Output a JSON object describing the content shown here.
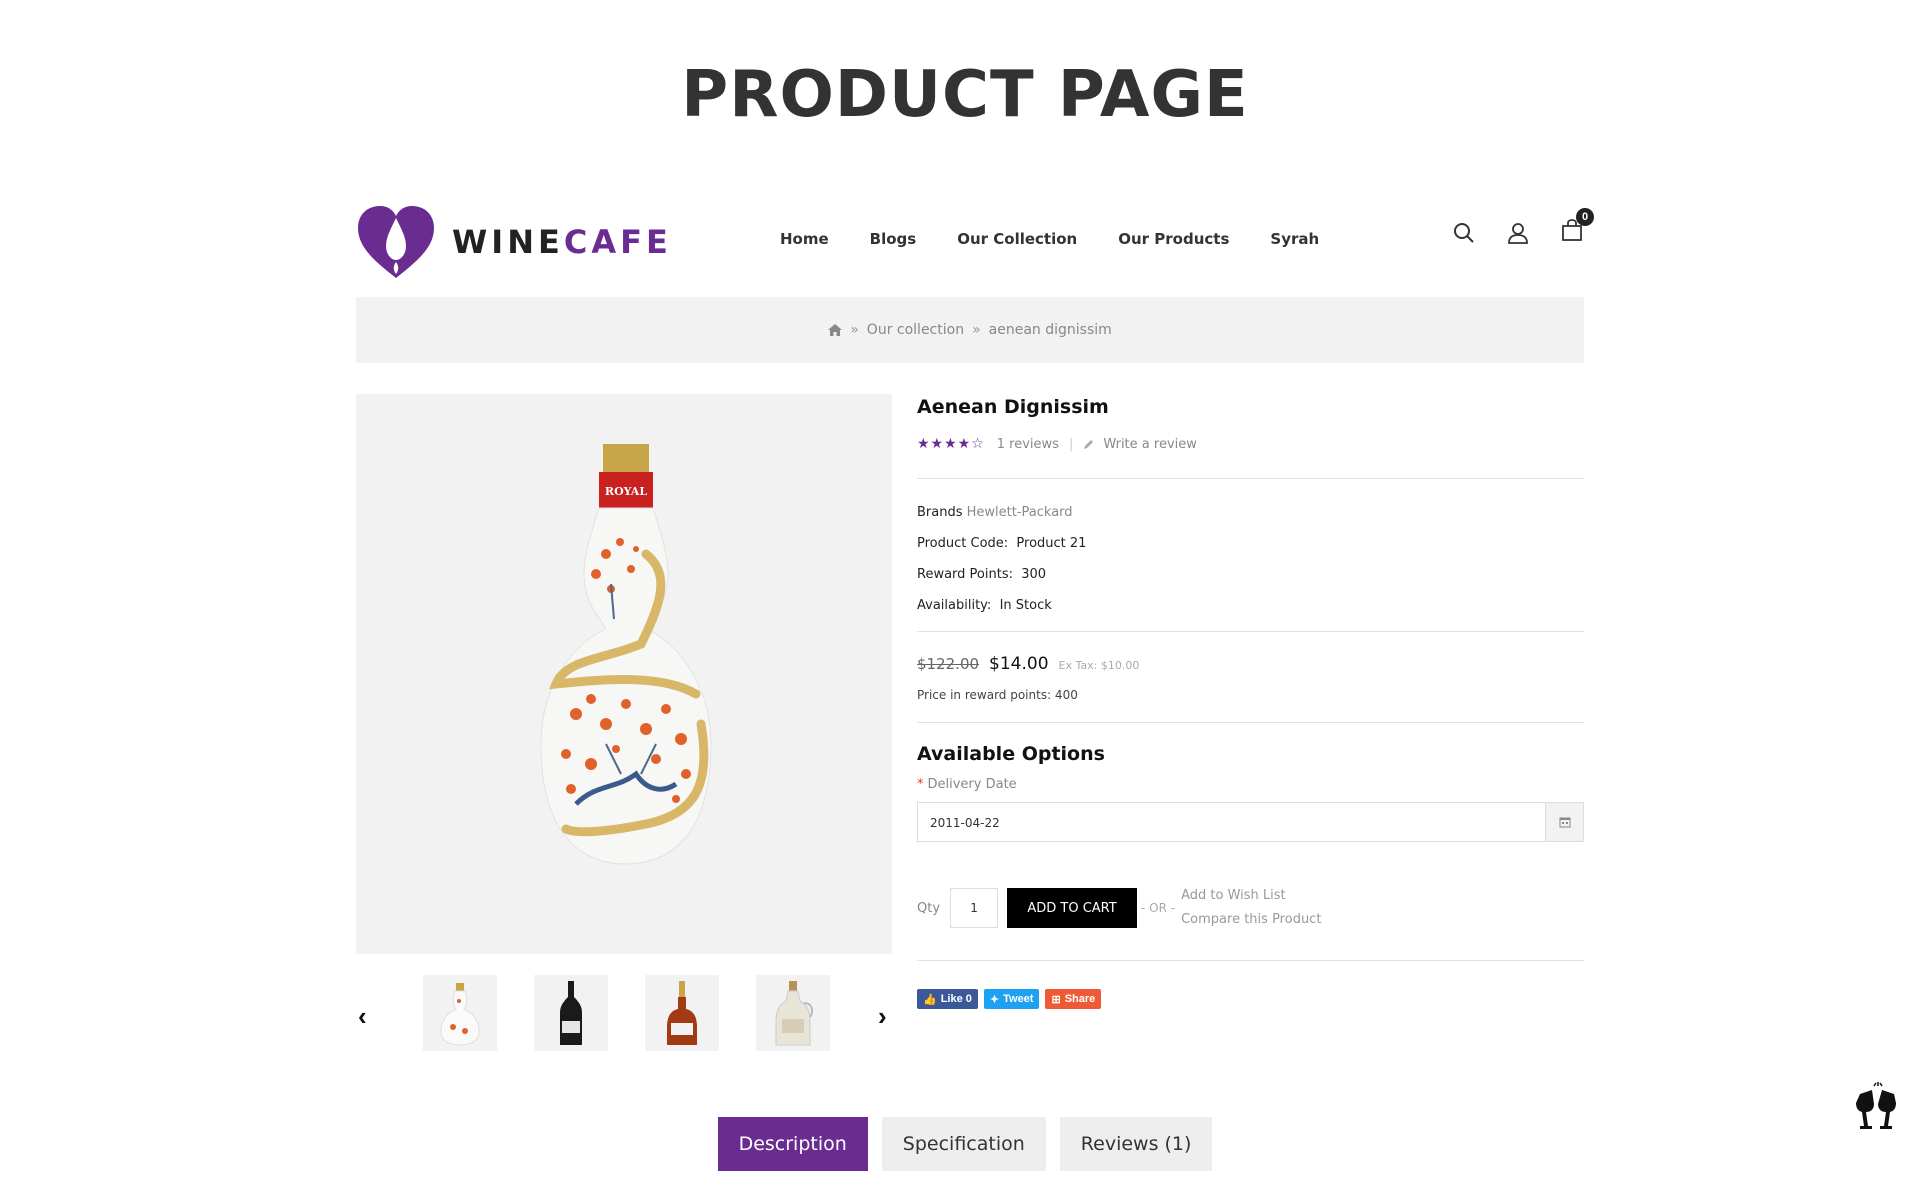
{
  "page_title": "PRODUCT PAGE",
  "brand": {
    "part1": "WINE",
    "part2": "CAFE",
    "accent_color": "#6a2c91"
  },
  "nav": {
    "items": [
      "Home",
      "Blogs",
      "Our Collection",
      "Our Products",
      "Syrah"
    ]
  },
  "header_icons": {
    "search": "search-icon",
    "account": "user-icon",
    "cart": "cart-icon",
    "cart_count": "0"
  },
  "breadcrumb": {
    "home_icon": "home-icon",
    "items": [
      "Our collection",
      "aenean dignissim"
    ]
  },
  "product": {
    "name": "Aenean Dignissim",
    "rating": {
      "stars": 4,
      "max": 5,
      "reviews_text": "1 reviews",
      "write_review": "Write a review"
    },
    "brand_label": "Brands",
    "brand_value": "Hewlett-Packard",
    "code_label": "Product Code:",
    "code_value": "Product 21",
    "reward_label": "Reward Points:",
    "reward_value": "300",
    "availability_label": "Availability:",
    "availability_value": "In Stock",
    "old_price": "$122.00",
    "new_price": "$14.00",
    "ex_tax": "Ex Tax: $10.00",
    "reward_price": "Price in reward points: 400"
  },
  "options": {
    "title": "Available Options",
    "required_mark": "*",
    "delivery_label": "Delivery Date",
    "delivery_value": "2011-04-22"
  },
  "cart": {
    "qty_label": "Qty",
    "qty_value": "1",
    "add_to_cart": "ADD TO CART",
    "or_text": "- OR -",
    "wish_list": "Add to Wish List",
    "compare": "Compare this Product"
  },
  "social": {
    "like": "Like 0",
    "tweet": "Tweet",
    "share": "Share"
  },
  "tabs": [
    {
      "label": "Description",
      "active": true
    },
    {
      "label": "Specification",
      "active": false
    },
    {
      "label": "Reviews (1)",
      "active": false
    }
  ]
}
